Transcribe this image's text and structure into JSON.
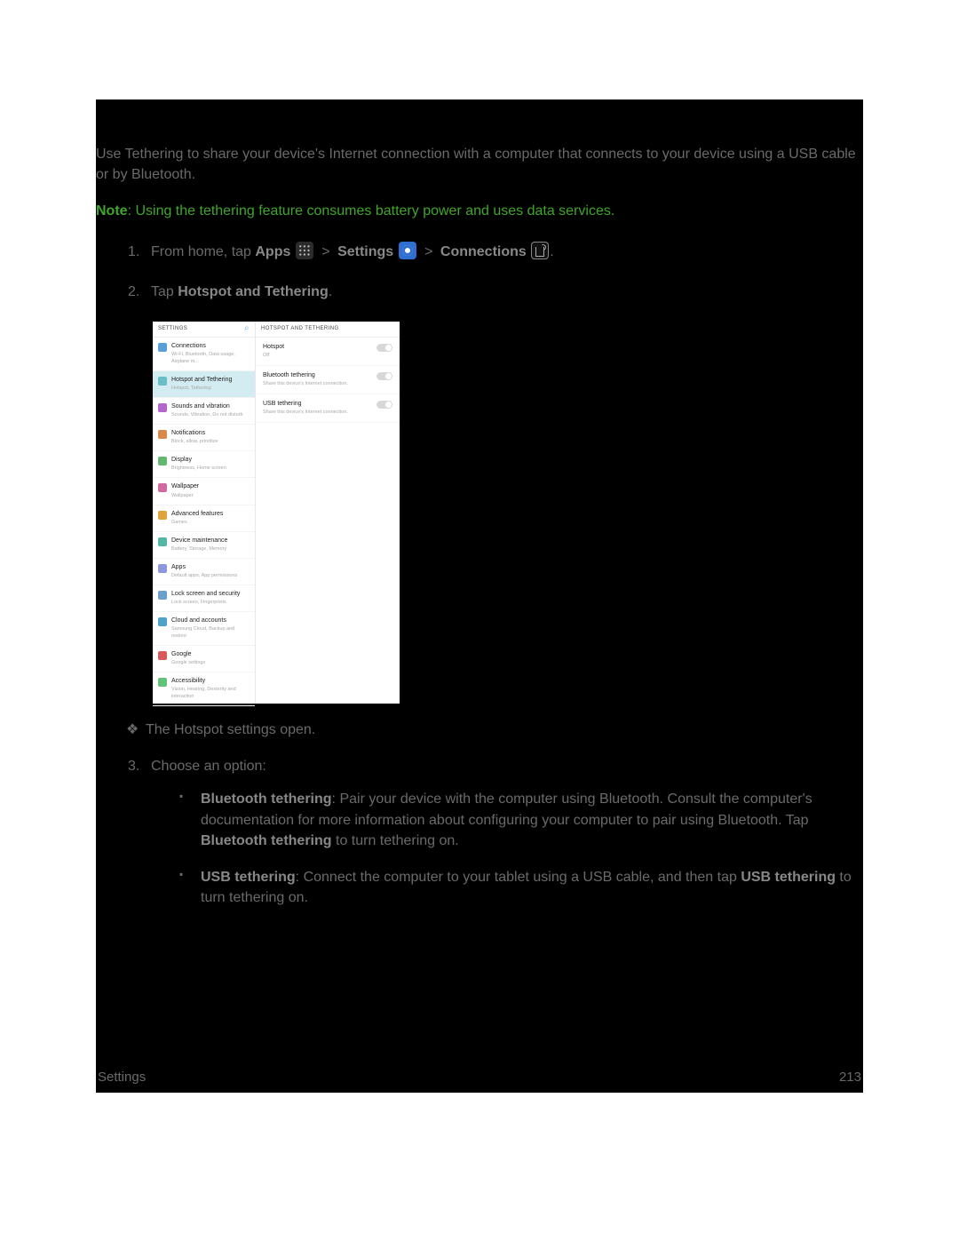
{
  "intro": "Use Tethering to share your device's Internet connection with a computer that connects to your device using a USB cable or by Bluetooth.",
  "note": {
    "label": "Note",
    "text": ": Using the tethering feature consumes battery power and uses data services."
  },
  "steps": {
    "s1": {
      "num": "1.",
      "pre": "From home, tap ",
      "apps": "Apps",
      "sep": " > ",
      "settings": "Settings",
      "connections": "Connections",
      "tail": "."
    },
    "s2": {
      "num": "2.",
      "pre": "Tap ",
      "bold": "Hotspot and Tethering",
      "tail": "."
    },
    "result": "The Hotspot settings open.",
    "s3": {
      "num": "3.",
      "text": "Choose an option:"
    }
  },
  "options": {
    "bt": {
      "title": "Bluetooth tethering",
      "a": ": Pair your device with the computer using Bluetooth. Consult the computer's documentation for more information about configuring your computer to pair using Bluetooth. Tap ",
      "b": "Bluetooth tethering",
      "c": " to turn tethering on."
    },
    "usb": {
      "title": "USB tethering",
      "a": ": Connect the computer to your tablet using a USB cable, and then tap ",
      "b": "USB tethering",
      "c": " to turn tethering on."
    }
  },
  "footer": {
    "section": "Settings",
    "page": "213"
  },
  "shot": {
    "left_header": "SETTINGS",
    "search_glyph": "⌕",
    "right_header": "HOTSPOT AND TETHERING",
    "left": [
      {
        "t": "Connections",
        "s": "Wi-Fi, Bluetooth, Data usage, Airplane m...",
        "c": "#5aa0d8"
      },
      {
        "t": "Hotspot and Tethering",
        "s": "Hotspot, Tethering",
        "c": "#6bbec7",
        "sel": true
      },
      {
        "t": "Sounds and vibration",
        "s": "Sounds, Vibration, Do not disturb",
        "c": "#b366cc"
      },
      {
        "t": "Notifications",
        "s": "Block, allow, prioritize",
        "c": "#d98a4a"
      },
      {
        "t": "Display",
        "s": "Brightness, Home screen",
        "c": "#63b86f"
      },
      {
        "t": "Wallpaper",
        "s": "Wallpaper",
        "c": "#d06aa0"
      },
      {
        "t": "Advanced features",
        "s": "Games",
        "c": "#e0a43d"
      },
      {
        "t": "Device maintenance",
        "s": "Battery, Storage, Memory",
        "c": "#52b7a4"
      },
      {
        "t": "Apps",
        "s": "Default apps, App permissions",
        "c": "#8f96e0"
      },
      {
        "t": "Lock screen and security",
        "s": "Lock screen, Fingerprints",
        "c": "#6aa0cc"
      },
      {
        "t": "Cloud and accounts",
        "s": "Samsung Cloud, Backup and restore",
        "c": "#4da4c9"
      },
      {
        "t": "Google",
        "s": "Google settings",
        "c": "#d85b5b"
      },
      {
        "t": "Accessibility",
        "s": "Vision, Hearing, Dexterity and interaction",
        "c": "#62c278"
      }
    ],
    "right": [
      {
        "t": "Hotspot",
        "s": "Off",
        "toggle": true
      },
      {
        "t": "Bluetooth tethering",
        "s": "Share this device's Internet connection.",
        "toggle": true
      },
      {
        "t": "USB tethering",
        "s": "Share this device's Internet connection.",
        "toggle": true
      }
    ]
  }
}
